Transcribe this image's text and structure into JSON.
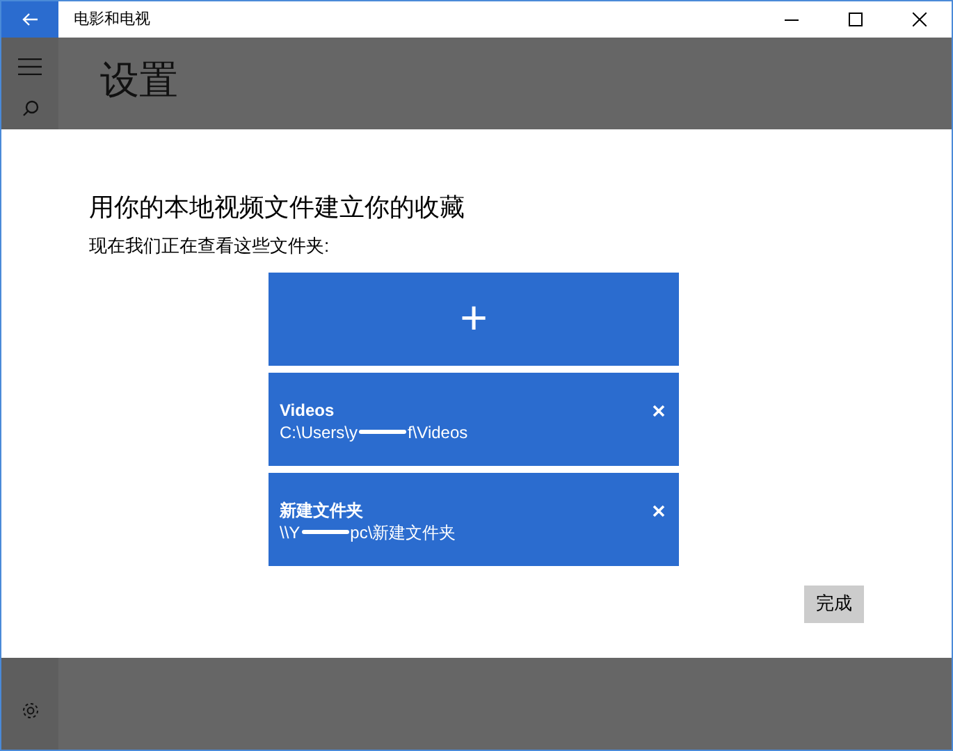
{
  "window": {
    "title": "电影和电视"
  },
  "page": {
    "title": "设置"
  },
  "dialog": {
    "heading": "用你的本地视频文件建立你的收藏",
    "subtitle": "现在我们正在查看这些文件夹:",
    "add_tile": {
      "label": "+"
    },
    "folders": [
      {
        "name": "Videos",
        "path_start": "C:\\Users\\y",
        "path_end": "f\\Videos"
      },
      {
        "name": "新建文件夹",
        "path_start": "\\\\Y",
        "path_end": "pc\\新建文件夹"
      }
    ],
    "done_button": "完成"
  }
}
